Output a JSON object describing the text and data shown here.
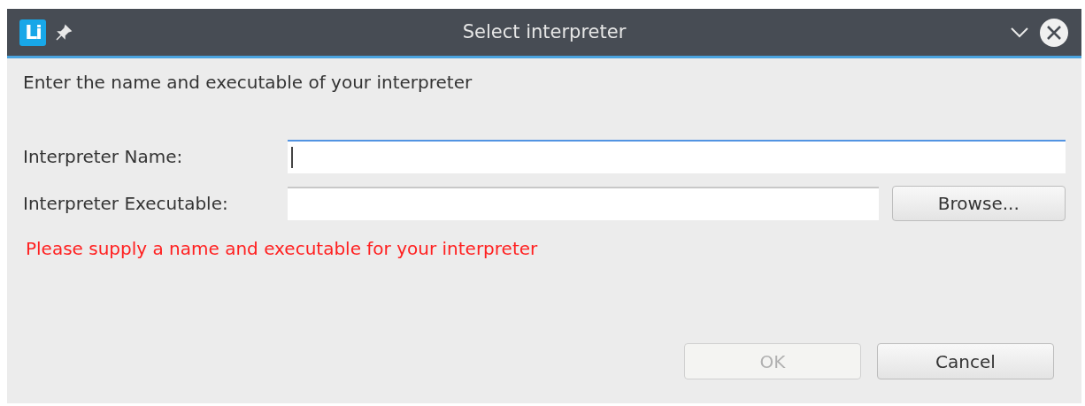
{
  "window": {
    "logo": "Li",
    "title": "Select interpreter"
  },
  "instruction": "Enter the name and executable of your interpreter",
  "fields": [
    {
      "label": "Interpreter Name:",
      "focused": true
    },
    {
      "label": "Interpreter Executable:",
      "focused": false,
      "button": "Browse..."
    }
  ],
  "error": "Please supply a name and executable for your interpreter",
  "buttons": [
    {
      "label": "OK",
      "disabled": true
    },
    {
      "label": "Cancel",
      "disabled": false
    }
  ]
}
